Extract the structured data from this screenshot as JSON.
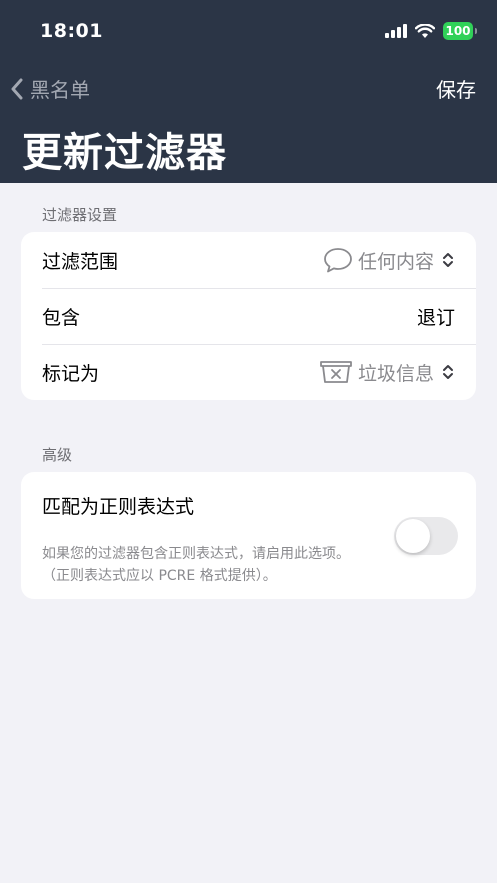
{
  "status_bar": {
    "time": "18:01",
    "battery": "100"
  },
  "nav": {
    "back_label": "黑名单",
    "save_label": "保存",
    "title": "更新过滤器"
  },
  "filter_settings": {
    "header": "过滤器设置",
    "rows": [
      {
        "label": "过滤范围",
        "value": "任何内容",
        "icon": "speech-bubble-icon"
      },
      {
        "label": "包含",
        "value": "退订"
      },
      {
        "label": "标记为",
        "value": "垃圾信息",
        "icon": "junk-tray-icon"
      }
    ]
  },
  "advanced": {
    "header": "高级",
    "regex_label": "匹配为正则表达式",
    "regex_description": "如果您的过滤器包含正则表达式，请启用此选项。（正则表达式应以 PCRE 格式提供）。",
    "regex_enabled": false
  }
}
